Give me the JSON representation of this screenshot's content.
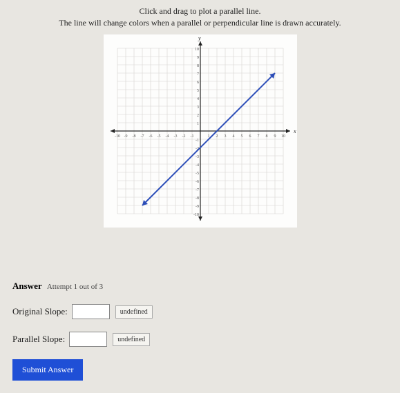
{
  "instructions": {
    "line1": "Click and drag to plot a parallel line.",
    "line2": "The line will change colors when a parallel or perpendicular line is drawn accurately."
  },
  "graph": {
    "x_label": "x",
    "y_label": "y",
    "x_range": [
      -10,
      10
    ],
    "y_range": [
      -10,
      10
    ],
    "ticks_x": [
      "-10",
      "-9",
      "-8",
      "-7",
      "-6",
      "-5",
      "-4",
      "-3",
      "-2",
      "-1",
      "1",
      "2",
      "3",
      "4",
      "5",
      "6",
      "7",
      "8",
      "9",
      "10"
    ],
    "ticks_y": [
      "10",
      "9",
      "8",
      "7",
      "6",
      "5",
      "4",
      "3",
      "2",
      "1",
      "-1",
      "-2",
      "-3",
      "-4",
      "-5",
      "-6",
      "-7",
      "-8",
      "-9",
      "-10"
    ],
    "line": {
      "p1": [
        -7,
        -9
      ],
      "p2": [
        9,
        7
      ],
      "color": "#2b4db8"
    }
  },
  "answer": {
    "header_label": "Answer",
    "attempt_text": "Attempt 1 out of 3",
    "original_slope_label": "Original Slope:",
    "original_slope_value": "",
    "parallel_slope_label": "Parallel Slope:",
    "parallel_slope_value": "",
    "undefined_btn": "undefined",
    "submit_label": "Submit Answer"
  }
}
